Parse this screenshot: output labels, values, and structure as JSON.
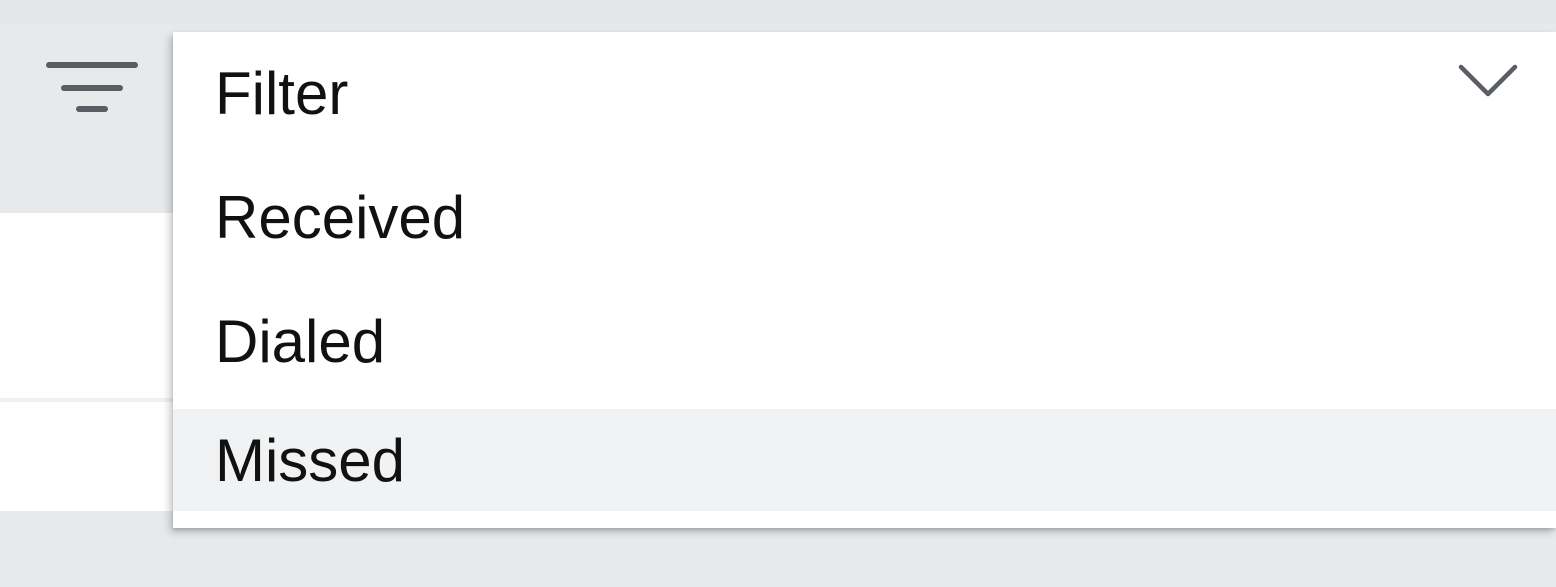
{
  "filter": {
    "icon": "filter-icon",
    "dropdown": {
      "selected_label": "Filter",
      "expand_icon": "chevron-down-icon",
      "options": [
        {
          "label": "Received"
        },
        {
          "label": "Dialed"
        },
        {
          "label": "Missed",
          "highlighted": true
        }
      ]
    }
  },
  "colors": {
    "background_gray": "#e7e9eb",
    "icon_gray": "#5a5e63",
    "text": "#111111",
    "highlight": "#f1f2f3"
  }
}
